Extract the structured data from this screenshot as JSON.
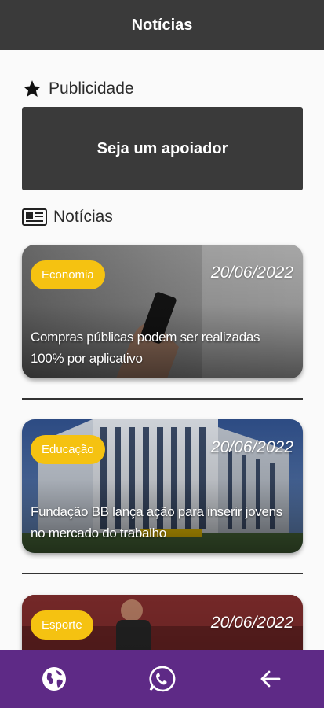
{
  "appbar": {
    "title": "Notícias"
  },
  "sections": {
    "ads": {
      "title": "Publicidade",
      "icon": "star-icon"
    },
    "news": {
      "title": "Notícias",
      "icon": "newspaper-icon"
    }
  },
  "ad": {
    "text": "Seja um apoiador"
  },
  "news": [
    {
      "category": "Economia",
      "date": "20/06/2022",
      "title": "Compras públicas podem ser realizadas 100% por aplicativo"
    },
    {
      "category": "Educação",
      "date": "20/06/2022",
      "title": "Fundação BB lança ação para inserir jovens no mercado do trabalho"
    },
    {
      "category": "Esporte",
      "date": "20/06/2022",
      "title": ""
    }
  ],
  "bottom_nav": [
    {
      "icon": "globe-icon"
    },
    {
      "icon": "whatsapp-icon"
    },
    {
      "icon": "back-arrow-icon"
    }
  ],
  "colors": {
    "appbar": "#3a3a3a",
    "badge": "#f5c211",
    "bottom_bar": "#5e2a86"
  }
}
